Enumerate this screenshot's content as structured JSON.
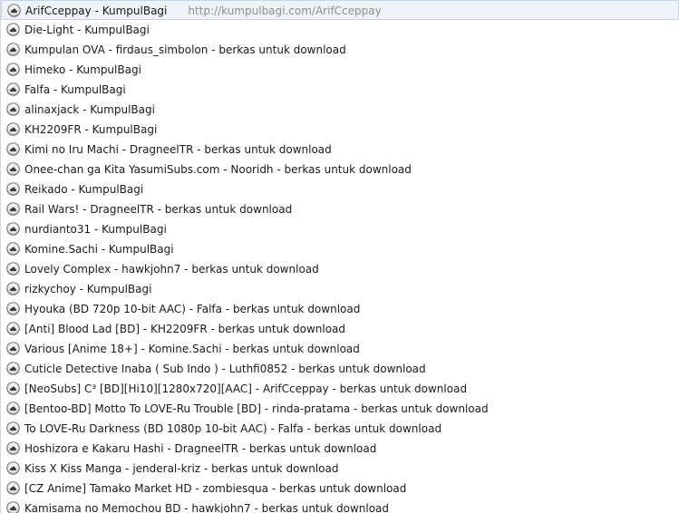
{
  "autocomplete": {
    "items": [
      {
        "title": "ArifCceppay - KumpulBagi",
        "url": "http://kumpulbagi.com/ArifCceppay",
        "icon": "kumpulbagi-favicon-icon",
        "selected": true
      },
      {
        "title": "Die-Light - KumpulBagi",
        "url": "",
        "icon": "kumpulbagi-favicon-icon"
      },
      {
        "title": "Kumpulan OVA - firdaus_simbolon - berkas untuk download",
        "url": "",
        "icon": "kumpulbagi-favicon-icon"
      },
      {
        "title": "Himeko - KumpulBagi",
        "url": "",
        "icon": "kumpulbagi-favicon-icon"
      },
      {
        "title": "Falfa - KumpulBagi",
        "url": "",
        "icon": "kumpulbagi-favicon-icon"
      },
      {
        "title": "alinaxjack - KumpulBagi",
        "url": "",
        "icon": "kumpulbagi-favicon-icon"
      },
      {
        "title": "KH2209FR - KumpulBagi",
        "url": "",
        "icon": "kumpulbagi-favicon-icon"
      },
      {
        "title": "Kimi no Iru Machi - DragneelTR - berkas untuk download",
        "url": "",
        "icon": "kumpulbagi-favicon-icon"
      },
      {
        "title": "Onee-chan ga Kita YasumiSubs.com - Nooridh - berkas untuk download",
        "url": "",
        "icon": "kumpulbagi-favicon-icon"
      },
      {
        "title": "Reikado - KumpulBagi",
        "url": "",
        "icon": "kumpulbagi-favicon-icon"
      },
      {
        "title": "Rail Wars! - DragneelTR - berkas untuk download",
        "url": "",
        "icon": "kumpulbagi-favicon-icon"
      },
      {
        "title": "nurdianto31 - KumpulBagi",
        "url": "",
        "icon": "kumpulbagi-favicon-icon"
      },
      {
        "title": "Komine.Sachi - KumpulBagi",
        "url": "",
        "icon": "kumpulbagi-favicon-icon"
      },
      {
        "title": "Lovely Complex - hawkjohn7 - berkas untuk download",
        "url": "",
        "icon": "kumpulbagi-favicon-icon"
      },
      {
        "title": "rizkychoy - KumpulBagi",
        "url": "",
        "icon": "kumpulbagi-favicon-icon"
      },
      {
        "title": "Hyouka (BD 720p 10-bit AAC) - Falfa - berkas untuk download",
        "url": "",
        "icon": "kumpulbagi-favicon-icon"
      },
      {
        "title": "[Anti] Blood Lad [BD] - KH2209FR - berkas untuk download",
        "url": "",
        "icon": "kumpulbagi-favicon-icon"
      },
      {
        "title": "Various [Anime 18+] - Komine.Sachi - berkas untuk download",
        "url": "",
        "icon": "kumpulbagi-favicon-icon"
      },
      {
        "title": "Cuticle Detective Inaba ( Sub Indo ) - Luthfi0852 - berkas untuk download",
        "url": "",
        "icon": "kumpulbagi-favicon-icon"
      },
      {
        "title": "[NeoSubs] C³ [BD][Hi10][1280x720][AAC] - ArifCceppay - berkas untuk download",
        "url": "",
        "icon": "kumpulbagi-favicon-icon"
      },
      {
        "title": "[Bentoo-BD] Motto To LOVE-Ru Trouble [BD] - rinda-pratama - berkas untuk download",
        "url": "",
        "icon": "kumpulbagi-favicon-icon"
      },
      {
        "title": "To LOVE-Ru Darkness (BD 1080p 10-bit AAC) - Falfa - berkas untuk download",
        "url": "",
        "icon": "kumpulbagi-favicon-icon"
      },
      {
        "title": "Hoshizora e Kakaru Hashi - DragneelTR - berkas untuk download",
        "url": "",
        "icon": "kumpulbagi-favicon-icon"
      },
      {
        "title": "Kiss X Kiss Manga - jenderal-kriz - berkas untuk download",
        "url": "",
        "icon": "kumpulbagi-favicon-icon"
      },
      {
        "title": "[CZ Anime] Tamako Market HD - zombiesqua - berkas untuk download",
        "url": "",
        "icon": "kumpulbagi-favicon-icon"
      },
      {
        "title": "Kamisama no Memochou BD - hawkjohn7 - berkas untuk download",
        "url": "",
        "icon": "kumpulbagi-favicon-icon"
      }
    ]
  }
}
